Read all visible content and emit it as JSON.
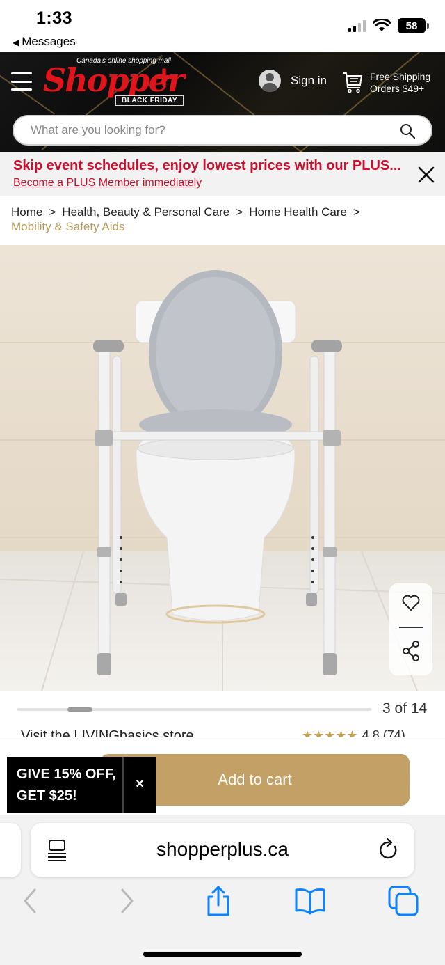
{
  "status_bar": {
    "time": "1:33",
    "back_app": "Messages",
    "battery": "58"
  },
  "header": {
    "logo": {
      "tagline": "Canada's online shopping mall",
      "wordmark": "Shopper",
      "plus": "+",
      "badge": "BLACK FRIDAY"
    },
    "sign_in": "Sign in",
    "shipping_line1": "Free Shipping",
    "shipping_line2": "Orders $49+",
    "search_placeholder": "What are you looking for?"
  },
  "promo": {
    "title": "Skip event schedules, enjoy lowest prices with our PLUS...",
    "link": "Become a PLUS Member immediately"
  },
  "breadcrumb": {
    "items": [
      "Home",
      "Health, Beauty & Personal Care",
      "Home Health Care"
    ],
    "separator": ">",
    "current": "Mobility & Safety Aids"
  },
  "gallery": {
    "counter": "3 of 14",
    "progress_fraction": 0.214
  },
  "store": {
    "link": "Visit the LIVINGbasics store",
    "stars": "★★★★★",
    "rating": "4.8 (74)"
  },
  "cart": {
    "add_to_cart": "Add to cart"
  },
  "offer": {
    "text": "GIVE 15% OFF,\nGET $25!",
    "close": "×"
  },
  "browser": {
    "url": "shopperplus.ca"
  },
  "icons": {
    "menu": "menu-icon",
    "cart": "cart-icon",
    "search": "search-icon",
    "close": "close-icon",
    "heart": "heart-icon",
    "share": "share-icon",
    "reader": "reader-icon",
    "reload": "reload-icon",
    "back": "back-icon",
    "forward": "forward-icon",
    "share_sheet": "share-sheet-icon",
    "bookmarks": "bookmarks-icon",
    "tabs": "tabs-icon"
  },
  "colors": {
    "brand_red": "#e0151b",
    "promo_red": "#c8102e",
    "gold": "#c3a065",
    "breadcrumb_current": "#b79b5c",
    "ios_blue": "#0a84ff"
  }
}
